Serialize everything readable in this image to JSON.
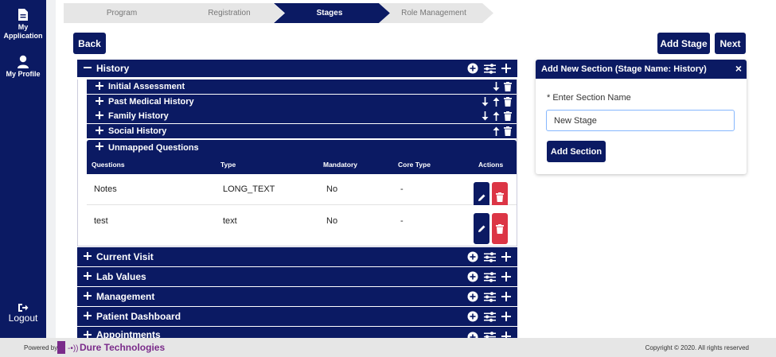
{
  "sidebar": {
    "items": [
      {
        "label_line1": "My",
        "label_line2": "Application",
        "icon": "document-icon"
      },
      {
        "label": "My Profile",
        "icon": "user-icon"
      }
    ],
    "logout_label": "Logout",
    "logout_icon": "logout-icon"
  },
  "stepper": {
    "steps": [
      {
        "label": "Program",
        "active": false
      },
      {
        "label": "Registration",
        "active": false
      },
      {
        "label": "Stages",
        "active": true
      },
      {
        "label": "Role Management",
        "active": false
      }
    ]
  },
  "toolbar": {
    "back_label": "Back",
    "add_stage_label": "Add Stage",
    "next_label": "Next"
  },
  "stages": [
    {
      "name": "History",
      "expanded": true
    },
    {
      "name": "Current Visit",
      "expanded": false
    },
    {
      "name": "Lab Values",
      "expanded": false
    },
    {
      "name": "Management",
      "expanded": false
    },
    {
      "name": "Patient Dashboard",
      "expanded": false
    },
    {
      "name": "Appointments",
      "expanded": false
    }
  ],
  "sections": [
    {
      "name": "Initial Assessment",
      "actions": [
        "down",
        "delete"
      ]
    },
    {
      "name": "Past Medical History",
      "actions": [
        "down",
        "up",
        "delete"
      ]
    },
    {
      "name": "Family History",
      "actions": [
        "down",
        "up",
        "delete"
      ]
    },
    {
      "name": "Social History",
      "actions": [
        "up",
        "delete"
      ]
    }
  ],
  "unmapped": {
    "title": "Unmapped Questions",
    "columns": [
      "Questions",
      "Type",
      "Mandatory",
      "Core Type",
      "Actions"
    ],
    "rows": [
      {
        "question": "Notes",
        "type": "LONG_TEXT",
        "mandatory": "No",
        "core_type": "-"
      },
      {
        "question": "test",
        "type": "text",
        "mandatory": "No",
        "core_type": "-"
      }
    ]
  },
  "add_section_card": {
    "title": "Add New Section (Stage Name: History)",
    "close": "×",
    "field_label": "* Enter Section Name",
    "field_value": "New Stage",
    "submit_label": "Add Section"
  },
  "footer": {
    "powered_by": "Powered by",
    "brand": "Dure Technologies",
    "copyright": "Copyright © 2020. All rights reserved"
  },
  "colors": {
    "primary": "#0b1a63",
    "danger": "#dc3545",
    "brand": "#7a2b8a",
    "step_inactive": "#e6e6e6"
  }
}
